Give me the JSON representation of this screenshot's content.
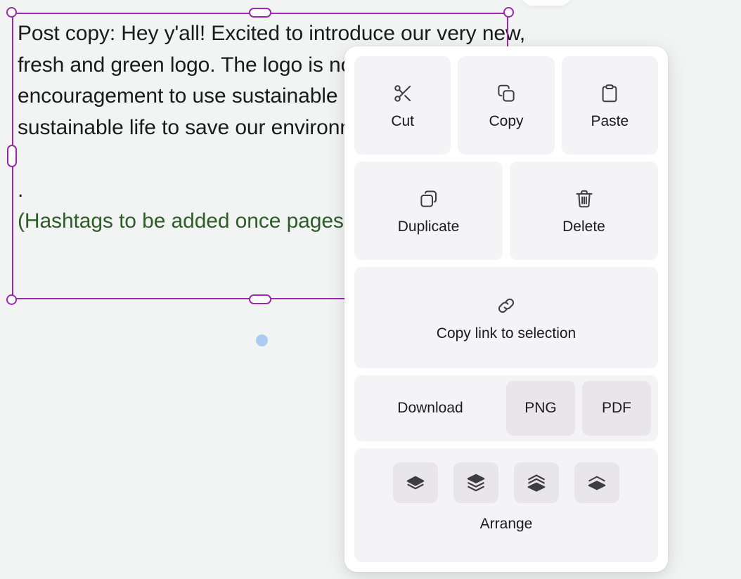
{
  "canvas": {
    "background_color": "#f2f3f3",
    "selection": {
      "border_color": "#9c27b0",
      "text_color": "#1b1b1b",
      "accent_text_color": "#2f5d2a",
      "text_main": "Post copy: Hey y'all! Excited to introduce our very new, fresh and green logo. The logo is not only about us but encouragement to use sustainable products and lead a sustainable life to save our environment.\n\n.\n",
      "text_accent": "(Hashtags to be added once pages are finalised)"
    },
    "blue_dot_color": "#aacbf2"
  },
  "context_menu": {
    "clipboard_actions": [
      {
        "label": "Cut",
        "icon": "scissors-icon"
      },
      {
        "label": "Copy",
        "icon": "copy-icon"
      },
      {
        "label": "Paste",
        "icon": "clipboard-icon"
      }
    ],
    "object_actions": [
      {
        "label": "Duplicate",
        "icon": "duplicate-icon"
      },
      {
        "label": "Delete",
        "icon": "trash-icon"
      }
    ],
    "copy_link": {
      "label": "Copy link to selection",
      "icon": "link-icon"
    },
    "download": {
      "label": "Download",
      "formats": [
        {
          "label": "PNG"
        },
        {
          "label": "PDF"
        }
      ]
    },
    "arrange": {
      "label": "Arrange",
      "buttons": [
        {
          "icon": "bring-forward-icon"
        },
        {
          "icon": "bring-to-front-icon"
        },
        {
          "icon": "send-backward-icon"
        },
        {
          "icon": "send-to-back-icon"
        }
      ]
    }
  }
}
